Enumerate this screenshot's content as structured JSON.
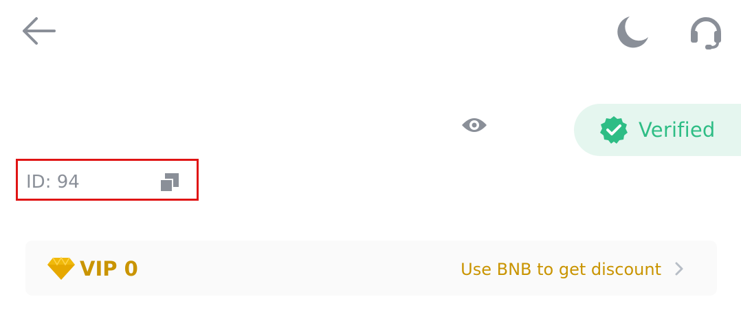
{
  "header": {
    "back_icon": "arrow-left-icon",
    "theme_icon": "moon-icon",
    "support_icon": "headset-icon"
  },
  "profile": {
    "visibility_icon": "eye-icon",
    "verified_label": "Verified",
    "verified_color": "#2ebd85",
    "id_text": "ID: 94",
    "copy_icon": "copy-icon",
    "highlight_color": "#e01414"
  },
  "vip": {
    "level_label": "VIP 0",
    "discount_label": "Use BNB to get discount",
    "gem_icon": "diamond-icon",
    "accent_color": "#c99400"
  }
}
